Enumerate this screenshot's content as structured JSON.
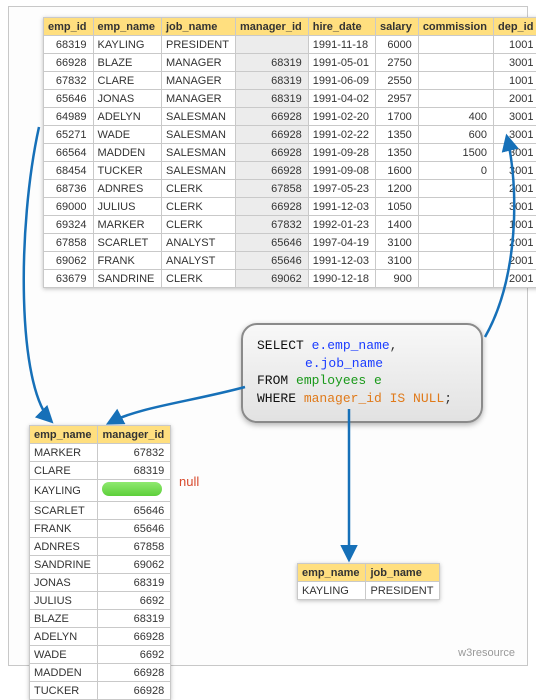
{
  "main": {
    "headers": [
      "emp_id",
      "emp_name",
      "job_name",
      "manager_id",
      "hire_date",
      "salary",
      "commission",
      "dep_id"
    ],
    "rows": [
      [
        "68319",
        "KAYLING",
        "PRESIDENT",
        "",
        "1991-11-18",
        "6000",
        "",
        "1001"
      ],
      [
        "66928",
        "BLAZE",
        "MANAGER",
        "68319",
        "1991-05-01",
        "2750",
        "",
        "3001"
      ],
      [
        "67832",
        "CLARE",
        "MANAGER",
        "68319",
        "1991-06-09",
        "2550",
        "",
        "1001"
      ],
      [
        "65646",
        "JONAS",
        "MANAGER",
        "68319",
        "1991-04-02",
        "2957",
        "",
        "2001"
      ],
      [
        "64989",
        "ADELYN",
        "SALESMAN",
        "66928",
        "1991-02-20",
        "1700",
        "400",
        "3001"
      ],
      [
        "65271",
        "WADE",
        "SALESMAN",
        "66928",
        "1991-02-22",
        "1350",
        "600",
        "3001"
      ],
      [
        "66564",
        "MADDEN",
        "SALESMAN",
        "66928",
        "1991-09-28",
        "1350",
        "1500",
        "3001"
      ],
      [
        "68454",
        "TUCKER",
        "SALESMAN",
        "66928",
        "1991-09-08",
        "1600",
        "0",
        "3001"
      ],
      [
        "68736",
        "ADNRES",
        "CLERK",
        "67858",
        "1997-05-23",
        "1200",
        "",
        "2001"
      ],
      [
        "69000",
        "JULIUS",
        "CLERK",
        "66928",
        "1991-12-03",
        "1050",
        "",
        "3001"
      ],
      [
        "69324",
        "MARKER",
        "CLERK",
        "67832",
        "1992-01-23",
        "1400",
        "",
        "1001"
      ],
      [
        "67858",
        "SCARLET",
        "ANALYST",
        "65646",
        "1997-04-19",
        "3100",
        "",
        "2001"
      ],
      [
        "69062",
        "FRANK",
        "ANALYST",
        "65646",
        "1991-12-03",
        "3100",
        "",
        "2001"
      ],
      [
        "63679",
        "SANDRINE",
        "CLERK",
        "69062",
        "1990-12-18",
        "900",
        "",
        "2001"
      ]
    ]
  },
  "sub": {
    "headers": [
      "emp_name",
      "manager_id"
    ],
    "rows": [
      [
        "MARKER",
        "67832"
      ],
      [
        "CLARE",
        "68319"
      ],
      [
        "KAYLING",
        "__NULL__"
      ],
      [
        "SCARLET",
        "65646"
      ],
      [
        "FRANK",
        "65646"
      ],
      [
        "ADNRES",
        "67858"
      ],
      [
        "SANDRINE",
        "69062"
      ],
      [
        "JONAS",
        "68319"
      ],
      [
        "JULIUS",
        "6692"
      ],
      [
        "BLAZE",
        "68319"
      ],
      [
        "ADELYN",
        "66928"
      ],
      [
        "WADE",
        "6692"
      ],
      [
        "MADDEN",
        "66928"
      ],
      [
        "TUCKER",
        "66928"
      ]
    ],
    "null_label": "null"
  },
  "result": {
    "headers": [
      "emp_name",
      "job_name"
    ],
    "rows": [
      [
        "KAYLING",
        "PRESIDENT"
      ]
    ]
  },
  "sql": {
    "select_kw": "SELECT ",
    "field1": "e.emp_name",
    "comma": ",",
    "field2": "e.job_name",
    "from_kw": "FROM ",
    "table": "employees e",
    "where_kw": "WHERE ",
    "cond": "manager_id IS NULL",
    "semi": ";"
  },
  "watermark": "w3resource"
}
